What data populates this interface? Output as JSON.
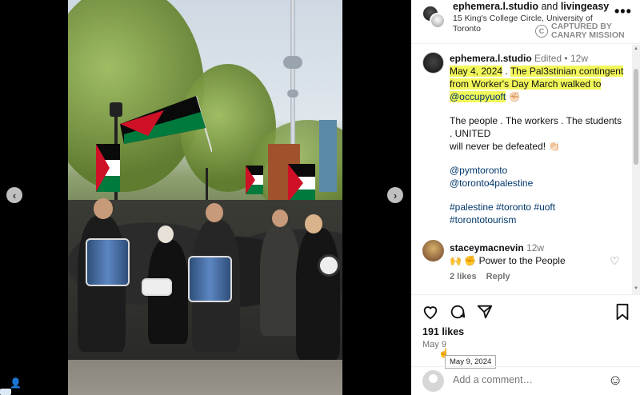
{
  "post": {
    "owner": "ephemera.l.studio",
    "and_text": "and",
    "collaborator": "livingeasy",
    "location": "15 King's College Circle, University of Toronto",
    "more_icon": "ellipsis-icon"
  },
  "watermark": {
    "line1": "CAPTURED BY",
    "line2": "CANARY MISSION"
  },
  "caption": {
    "username": "ephemera.l.studio",
    "edited": "Edited",
    "dot": "•",
    "age": "12w",
    "hl1": "May 4, 2024",
    "plain1": " . ",
    "hl2": "The Pal3stinian contingent from Worker's Day March walked to",
    "hl3": "@occupyuoft",
    "emoji1": "✊🏻",
    "p2_line1": "The people . The workers . The students . UNITED",
    "p2_line2": "will never be defeated!",
    "emoji2": "👏🏻",
    "mention1": "@pymtoronto",
    "mention2": "@toronto4palestine",
    "tags_line1": "#palestine #toronto #uoft",
    "tags_line2": "#torontotourism"
  },
  "comment": {
    "username": "staceymacnevin",
    "age": "12w",
    "emojis": "🙌 ✊",
    "text": "Power to the People",
    "likes": "2 likes",
    "reply": "Reply"
  },
  "actions": {
    "likes": "191 likes",
    "date": "May 9",
    "tooltip": "May 9, 2024"
  },
  "add_comment": {
    "placeholder": "Add a comment…"
  },
  "icons": {
    "prev": "‹",
    "next": "›",
    "heart": "♡",
    "comment": "◯",
    "share": "➤",
    "bookmark": "⚑",
    "emoji": "☺",
    "user_tag": "👤"
  }
}
